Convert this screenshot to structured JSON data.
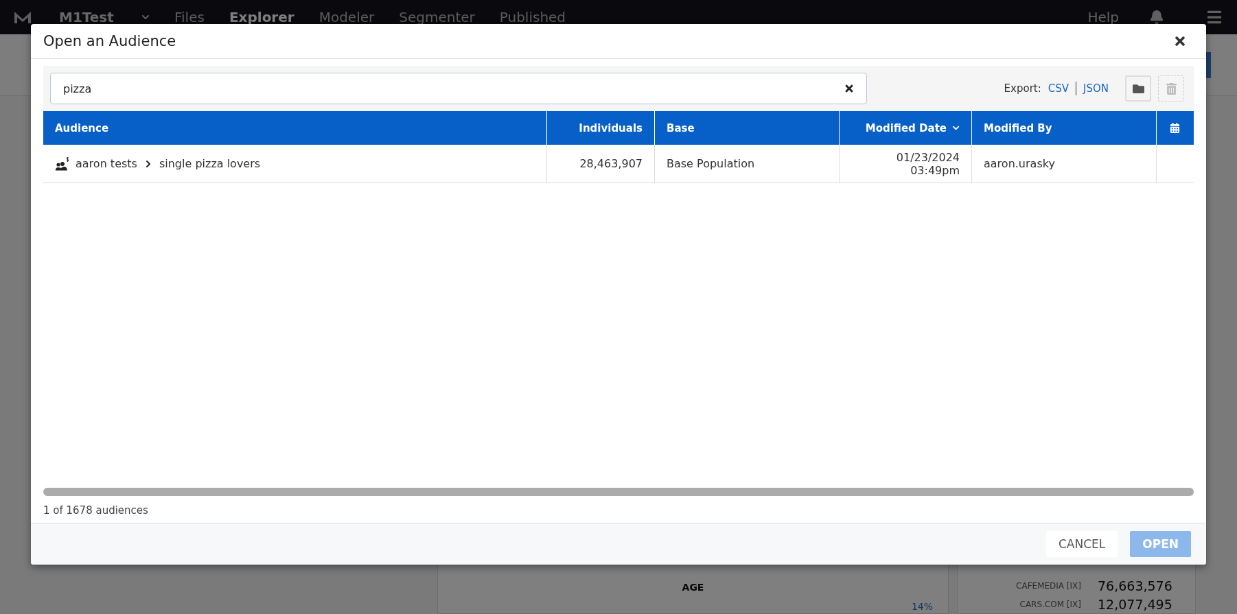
{
  "top_nav": {
    "brand": "M1Test",
    "items": [
      {
        "label": "Files",
        "selected": false
      },
      {
        "label": "Explorer",
        "selected": true
      },
      {
        "label": "Modeler",
        "selected": false
      },
      {
        "label": "Segmenter",
        "selected": false
      },
      {
        "label": "Published",
        "selected": false
      }
    ],
    "help": "Help"
  },
  "background": {
    "age_panel": {
      "title": "AGE",
      "value": "14%"
    },
    "publisher_rows": [
      {
        "name": "CAFEMEDIA [IX]",
        "count": "76,663,576"
      },
      {
        "name": "CARS.COM [IX]",
        "count": "12,077,495"
      }
    ]
  },
  "dialog": {
    "title": "Open an Audience",
    "search": {
      "value": "pizza"
    },
    "export": {
      "label": "Export:",
      "links": [
        "CSV",
        "JSON"
      ]
    },
    "tools": [
      {
        "kind": "folder",
        "disabled": false
      },
      {
        "kind": "trash",
        "disabled": true
      }
    ],
    "table": {
      "columns": [
        {
          "kind": "text",
          "label": "Audience",
          "sorted": false
        },
        {
          "kind": "text",
          "label": "Individuals",
          "sorted": false
        },
        {
          "kind": "text",
          "label": "Base",
          "sorted": false
        },
        {
          "kind": "text",
          "label": "Modified Date",
          "sorted": true
        },
        {
          "kind": "text",
          "label": "Modified By",
          "sorted": false
        },
        {
          "kind": "calendar",
          "sorted": false
        }
      ],
      "rows": [
        {
          "folder": "aaron tests",
          "name": "single pizza lovers",
          "individuals": "28,463,907",
          "base": "Base Population",
          "modified_date": "01/23/2024",
          "modified_time": "03:49pm",
          "modified_by": "aaron.urasky"
        }
      ]
    },
    "count": "1 of 1678 audiences",
    "buttons": [
      {
        "label": "CANCEL",
        "kind": "secondary",
        "disabled": false
      },
      {
        "label": "OPEN",
        "kind": "primary",
        "disabled": true
      }
    ]
  }
}
